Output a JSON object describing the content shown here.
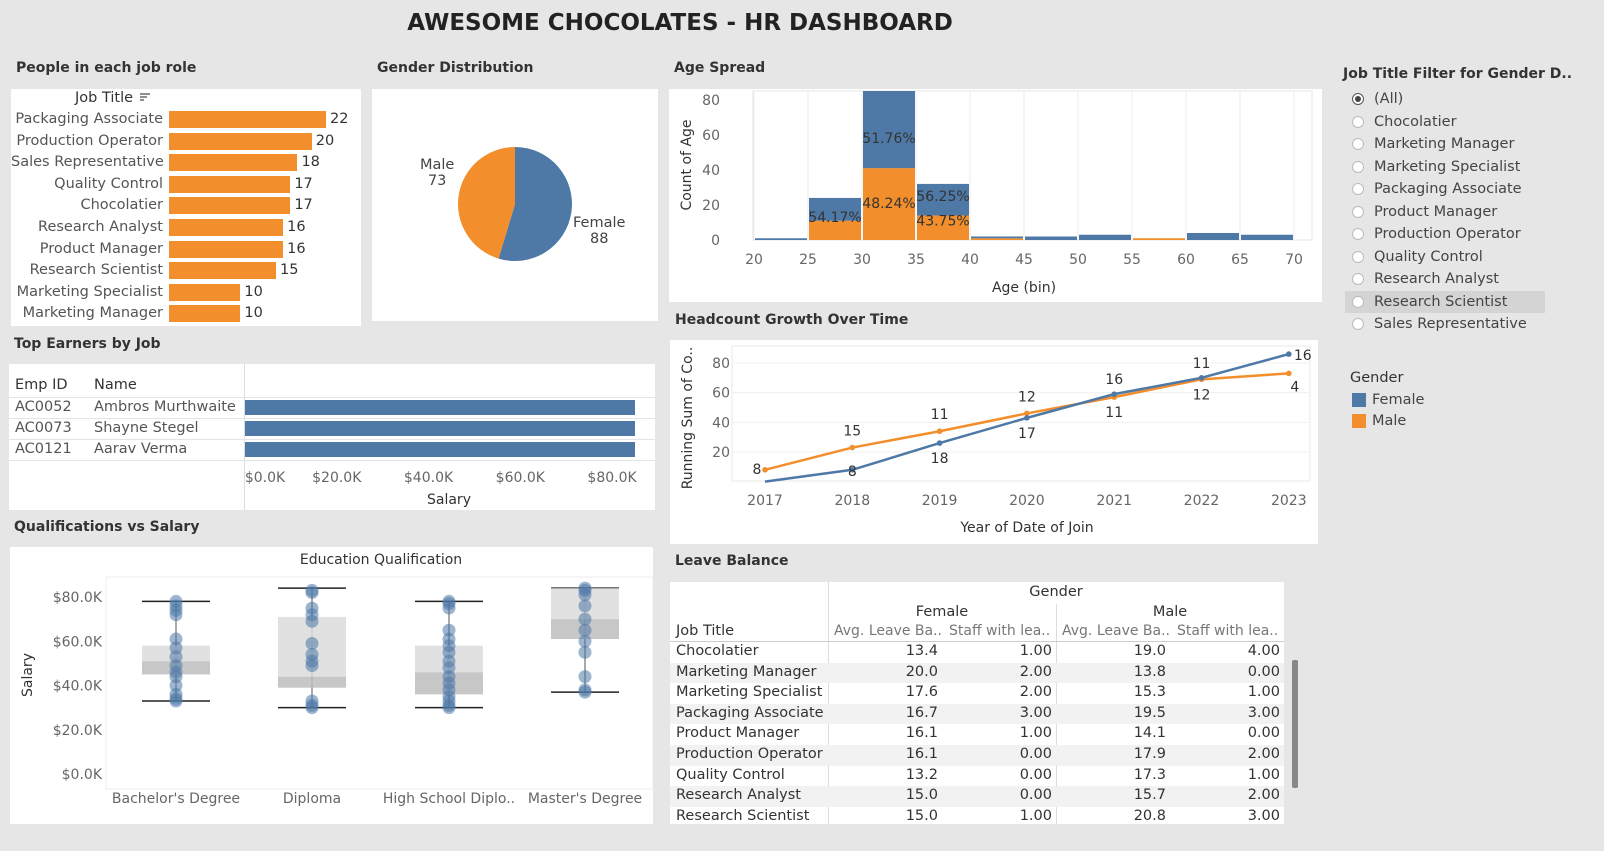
{
  "dashboard_title": "AWESOME CHOCOLATES - HR DASHBOARD",
  "colors": {
    "female": "#4e79a7",
    "male": "#f28e2b",
    "background": "#e6e6e6",
    "panel": "#ffffff"
  },
  "job_roles": {
    "title": "People in each job role",
    "header": "Job Title",
    "sort_icon": "sort-descending-icon",
    "rows": [
      {
        "label": "Packaging Associate",
        "value": 22
      },
      {
        "label": "Production Operator",
        "value": 20
      },
      {
        "label": "Sales Representative",
        "value": 18
      },
      {
        "label": "Quality Control",
        "value": 17
      },
      {
        "label": "Chocolatier",
        "value": 17
      },
      {
        "label": "Research Analyst",
        "value": 16
      },
      {
        "label": "Product Manager",
        "value": 16
      },
      {
        "label": "Research Scientist",
        "value": 15
      },
      {
        "label": "Marketing Specialist",
        "value": 10
      },
      {
        "label": "Marketing Manager",
        "value": 10
      }
    ]
  },
  "gender": {
    "title": "Gender Distribution",
    "male_label": "Male",
    "male_value": "73",
    "female_label": "Female",
    "female_value": "88"
  },
  "age_spread": {
    "title": "Age Spread",
    "ylabel": "Count of Age",
    "xlabel": "Age (bin)",
    "yticks": [
      "80",
      "60",
      "40",
      "20",
      "0"
    ],
    "xticks": [
      "20",
      "25",
      "30",
      "35",
      "40",
      "45",
      "50",
      "55",
      "60",
      "65",
      "70"
    ],
    "labels": {
      "b25_female": "54.17%",
      "b30_female": "51.76%",
      "b30_male": "48.24%",
      "b35_female": "56.25%",
      "b35_male": "43.75%"
    }
  },
  "top_earners": {
    "title": "Top Earners by Job",
    "col_emp": "Emp ID",
    "col_name": "Name",
    "rows": [
      {
        "id": "AC0052",
        "name": "Ambros Murthwaite",
        "salary": 85000
      },
      {
        "id": "AC0073",
        "name": "Shayne Stegel",
        "salary": 85000
      },
      {
        "id": "AC0121",
        "name": "Aarav Verma",
        "salary": 85000
      }
    ],
    "xticks": [
      "$0.0K",
      "$20.0K",
      "$40.0K",
      "$60.0K",
      "$80.0K"
    ],
    "xlabel": "Salary"
  },
  "headcount": {
    "title": "Headcount Growth Over Time",
    "ylabel": "Running Sum of Co..",
    "xlabel": "Year of Date of Join",
    "yticks": [
      "80",
      "60",
      "40",
      "20"
    ],
    "years": [
      "2017",
      "2018",
      "2019",
      "2020",
      "2021",
      "2022",
      "2023"
    ],
    "female_labels": [
      "8",
      "18",
      "17",
      "16",
      "11",
      "16"
    ],
    "male_labels": [
      "8",
      "15",
      "11",
      "12",
      "11",
      "12",
      "4"
    ]
  },
  "qualifications": {
    "title": "Qualifications vs Salary",
    "header": "Education Qualification",
    "ylabel": "Salary",
    "yticks": [
      "$80.0K",
      "$60.0K",
      "$40.0K",
      "$20.0K",
      "$0.0K"
    ],
    "categories": [
      "Bachelor's Degree",
      "Diploma",
      "High School Diplo..",
      "Master's Degree"
    ]
  },
  "filter": {
    "title": "Job Title Filter for Gender D..",
    "options": [
      "(All)",
      "Chocolatier",
      "Marketing Manager",
      "Marketing Specialist",
      "Packaging Associate",
      "Product Manager",
      "Production Operator",
      "Quality Control",
      "Research Analyst",
      "Research Scientist",
      "Sales Representative"
    ],
    "selected": "(All)",
    "hovered": "Research Scientist"
  },
  "legend": {
    "title": "Gender",
    "female": "Female",
    "male": "Male"
  },
  "leave_balance": {
    "title": "Leave Balance",
    "group_header": "Gender",
    "female_header": "Female",
    "male_header": "Male",
    "job_header": "Job Title",
    "col_avg": "Avg. Leave Ba..",
    "col_staff": "Staff with lea..",
    "rows": [
      {
        "job": "Chocolatier",
        "f_avg": "13.4",
        "f_staff": "1.00",
        "m_avg": "19.0",
        "m_staff": "4.00"
      },
      {
        "job": "Marketing Manager",
        "f_avg": "20.0",
        "f_staff": "2.00",
        "m_avg": "13.8",
        "m_staff": "0.00"
      },
      {
        "job": "Marketing Specialist",
        "f_avg": "17.6",
        "f_staff": "2.00",
        "m_avg": "15.3",
        "m_staff": "1.00"
      },
      {
        "job": "Packaging Associate",
        "f_avg": "16.7",
        "f_staff": "3.00",
        "m_avg": "19.5",
        "m_staff": "3.00"
      },
      {
        "job": "Product Manager",
        "f_avg": "16.1",
        "f_staff": "1.00",
        "m_avg": "14.1",
        "m_staff": "0.00"
      },
      {
        "job": "Production Operator",
        "f_avg": "16.1",
        "f_staff": "0.00",
        "m_avg": "17.9",
        "m_staff": "2.00"
      },
      {
        "job": "Quality Control",
        "f_avg": "13.2",
        "f_staff": "0.00",
        "m_avg": "17.3",
        "m_staff": "1.00"
      },
      {
        "job": "Research Analyst",
        "f_avg": "15.0",
        "f_staff": "0.00",
        "m_avg": "15.7",
        "m_staff": "2.00"
      },
      {
        "job": "Research Scientist",
        "f_avg": "15.0",
        "f_staff": "1.00",
        "m_avg": "20.8",
        "m_staff": "3.00"
      }
    ]
  },
  "chart_data": [
    {
      "type": "bar",
      "title": "People in each job role",
      "categories": [
        "Packaging Associate",
        "Production Operator",
        "Sales Representative",
        "Quality Control",
        "Chocolatier",
        "Research Analyst",
        "Product Manager",
        "Research Scientist",
        "Marketing Specialist",
        "Marketing Manager"
      ],
      "values": [
        22,
        20,
        18,
        17,
        17,
        16,
        16,
        15,
        10,
        10
      ]
    },
    {
      "type": "pie",
      "title": "Gender Distribution",
      "categories": [
        "Female",
        "Male"
      ],
      "values": [
        88,
        73
      ]
    },
    {
      "type": "bar",
      "title": "Age Spread",
      "xlabel": "Age (bin)",
      "ylabel": "Count of Age",
      "categories": [
        "20",
        "25",
        "30",
        "35",
        "40",
        "45",
        "50",
        "55",
        "60",
        "65"
      ],
      "series": [
        {
          "name": "Male",
          "values": [
            0,
            11,
            41,
            14,
            1,
            0,
            0,
            1,
            0,
            0
          ]
        },
        {
          "name": "Female",
          "values": [
            1,
            13,
            44,
            18,
            1,
            2,
            3,
            0,
            4,
            3
          ]
        }
      ],
      "ylim": [
        0,
        85
      ]
    },
    {
      "type": "bar",
      "title": "Top Earners by Job",
      "categories": [
        "AC0052",
        "AC0073",
        "AC0121"
      ],
      "values": [
        85000,
        85000,
        85000
      ],
      "xlabel": "Salary",
      "xlim": [
        0,
        85000
      ]
    },
    {
      "type": "line",
      "title": "Headcount Growth Over Time",
      "x": [
        2017,
        2018,
        2019,
        2020,
        2021,
        2022,
        2023
      ],
      "series": [
        {
          "name": "Female",
          "values": [
            0,
            8,
            26,
            43,
            59,
            70,
            86
          ]
        },
        {
          "name": "Male",
          "values": [
            8,
            23,
            34,
            46,
            57,
            69,
            73
          ]
        }
      ],
      "xlabel": "Year of Date of Join",
      "ylabel": "Running Sum of Co..",
      "ylim": [
        0,
        90
      ]
    },
    {
      "type": "scatter",
      "title": "Qualifications vs Salary",
      "categories": [
        "Bachelor's Degree",
        "Diploma",
        "High School Diplo..",
        "Master's Degree"
      ],
      "boxes": [
        {
          "min": 33000,
          "q1": 45000,
          "median": 51000,
          "q3": 58000,
          "max": 78000
        },
        {
          "min": 30000,
          "q1": 39000,
          "median": 44000,
          "q3": 71000,
          "max": 84000
        },
        {
          "min": 30000,
          "q1": 36000,
          "median": 46000,
          "q3": 58000,
          "max": 78000
        },
        {
          "min": 37000,
          "q1": 61000,
          "median": 70000,
          "q3": 84000,
          "max": 84000
        }
      ],
      "ylabel": "Salary",
      "ylim": [
        0,
        90000
      ]
    }
  ]
}
